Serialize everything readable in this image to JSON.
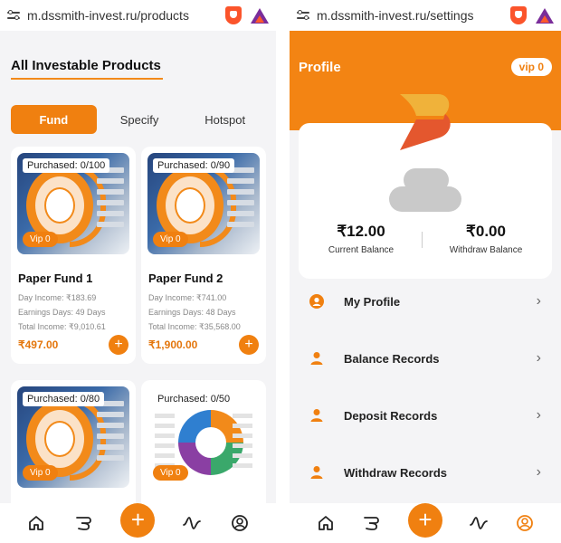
{
  "left": {
    "url": "m.dssmith-invest.ru/products",
    "page_title": "All Investable Products",
    "tabs": [
      "Fund",
      "Specify",
      "Hotspot"
    ],
    "active_tab": "Fund",
    "products": [
      {
        "purchased": "Purchased: 0/100",
        "vip": "Vip 0",
        "name": "Paper Fund 1",
        "day_income": "Day Income: ₹183.69",
        "earning_days": "Earnings Days: 49 Days",
        "total_income": "Total Income: ₹9,010.61",
        "price": "₹497.00"
      },
      {
        "purchased": "Purchased: 0/90",
        "vip": "Vip 0",
        "name": "Paper Fund 2",
        "day_income": "Day Income: ₹741.00",
        "earning_days": "Earnings Days: 48 Days",
        "total_income": "Total Income: ₹35,568.00",
        "price": "₹1,900.00"
      },
      {
        "purchased": "Purchased: 0/80",
        "vip": "Vip 0"
      },
      {
        "purchased": "Purchased: 0/50",
        "vip": "Vip 0"
      }
    ]
  },
  "right": {
    "url": "m.dssmith-invest.ru/settings",
    "page_title": "Profile",
    "vip": "vip 0",
    "current_balance": "₹12.00",
    "current_balance_label": "Current Balance",
    "withdraw_balance": "₹0.00",
    "withdraw_balance_label": "Withdraw Balance",
    "menu": [
      "My Profile",
      "Balance Records",
      "Deposit Records",
      "Withdraw Records"
    ]
  },
  "nav": [
    "home-icon",
    "product-icon",
    "add-icon",
    "activity-icon",
    "user-icon"
  ],
  "colors": {
    "accent": "#f08010",
    "header": "#f38413",
    "price": "#e4760c"
  }
}
